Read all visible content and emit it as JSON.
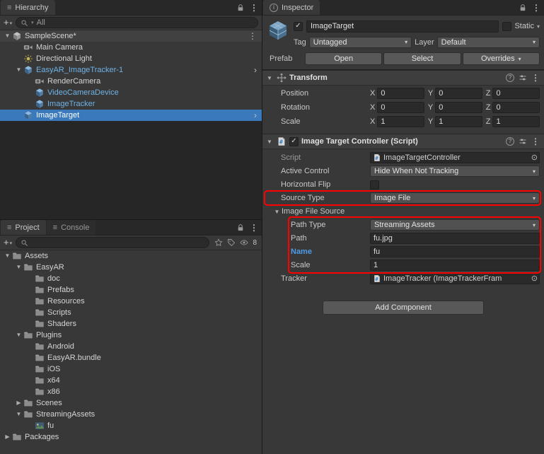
{
  "glyphs": {
    "hamburger": "≡",
    "kebab": "⋮",
    "caret": "▾",
    "plus": "+",
    "chevron": "›",
    "picker": "⊙",
    "check": "✓",
    "help": "?",
    "info": "i",
    "arrow_open": "▼",
    "arrow_closed": "▶"
  },
  "colors": {
    "selection": "#3a79bb",
    "prefab_text": "#6fb3e6",
    "highlight": "#ff0000"
  },
  "hierarchy": {
    "tab_label": "Hierarchy",
    "search_value": "All",
    "rows": [
      {
        "label": "SampleScene*",
        "icon": "unity-scene",
        "arrow": "▼",
        "indent": 0,
        "cls": "scene-row",
        "right": "⋮"
      },
      {
        "label": "Main Camera",
        "icon": "camera",
        "arrow": "",
        "indent": 1,
        "right": ""
      },
      {
        "label": "Directional Light",
        "icon": "light",
        "arrow": "",
        "indent": 1,
        "right": ""
      },
      {
        "label": "EasyAR_ImageTracker-1",
        "icon": "prefab-cube",
        "arrow": "▼",
        "indent": 1,
        "cls": "prefab",
        "right": "›"
      },
      {
        "label": "RenderCamera",
        "icon": "camera",
        "arrow": "",
        "indent": 2,
        "right": ""
      },
      {
        "label": "VideoCameraDevice",
        "icon": "prefab-cube",
        "arrow": "",
        "indent": 2,
        "cls": "prefab",
        "right": ""
      },
      {
        "label": "ImageTracker",
        "icon": "prefab-cube",
        "arrow": "",
        "indent": 2,
        "cls": "prefab",
        "right": ""
      },
      {
        "label": "ImageTarget",
        "icon": "prefab-cube",
        "arrow": "",
        "indent": 1,
        "cls": "selected",
        "right": "›"
      }
    ]
  },
  "project": {
    "tab_label": "Project",
    "console_tab_label": "Console",
    "search_value": "",
    "hidden_count": "8",
    "rows": [
      {
        "label": "Assets",
        "icon": "folder",
        "arrow": "▼",
        "indent": 0
      },
      {
        "label": "EasyAR",
        "icon": "folder",
        "arrow": "▼",
        "indent": 1
      },
      {
        "label": "doc",
        "icon": "folder",
        "arrow": "",
        "indent": 2
      },
      {
        "label": "Prefabs",
        "icon": "folder",
        "arrow": "",
        "indent": 2
      },
      {
        "label": "Resources",
        "icon": "folder",
        "arrow": "",
        "indent": 2
      },
      {
        "label": "Scripts",
        "icon": "folder",
        "arrow": "",
        "indent": 2
      },
      {
        "label": "Shaders",
        "icon": "folder",
        "arrow": "",
        "indent": 2
      },
      {
        "label": "Plugins",
        "icon": "folder",
        "arrow": "▼",
        "indent": 1
      },
      {
        "label": "Android",
        "icon": "folder",
        "arrow": "",
        "indent": 2
      },
      {
        "label": "EasyAR.bundle",
        "icon": "folder",
        "arrow": "",
        "indent": 2
      },
      {
        "label": "iOS",
        "icon": "folder",
        "arrow": "",
        "indent": 2
      },
      {
        "label": "x64",
        "icon": "folder",
        "arrow": "",
        "indent": 2
      },
      {
        "label": "x86",
        "icon": "folder",
        "arrow": "",
        "indent": 2
      },
      {
        "label": "Scenes",
        "icon": "folder",
        "arrow": "▶",
        "indent": 1
      },
      {
        "label": "StreamingAssets",
        "icon": "folder",
        "arrow": "▼",
        "indent": 1
      },
      {
        "label": "fu",
        "icon": "image",
        "arrow": "",
        "indent": 2
      },
      {
        "label": "Packages",
        "icon": "folder",
        "arrow": "▶",
        "indent": 0
      }
    ]
  },
  "inspector": {
    "tab_label": "Inspector",
    "header": {
      "name": "ImageTarget",
      "static_label": "Static",
      "tag_label": "Tag",
      "tag_value": "Untagged",
      "layer_label": "Layer",
      "layer_value": "Default",
      "prefab_label": "Prefab",
      "open_label": "Open",
      "select_label": "Select",
      "overrides_label": "Overrides"
    },
    "transform": {
      "title": "Transform",
      "axes": [
        "X",
        "Y",
        "Z"
      ],
      "rows": [
        {
          "label": "Position",
          "x": "0",
          "y": "0",
          "z": "0"
        },
        {
          "label": "Rotation",
          "x": "0",
          "y": "0",
          "z": "0"
        },
        {
          "label": "Scale",
          "x": "1",
          "y": "1",
          "z": "1"
        }
      ]
    },
    "controller": {
      "title": "Image Target Controller (Script)",
      "script_label": "Script",
      "script_value": "ImageTargetController",
      "active_control_label": "Active Control",
      "active_control_value": "Hide When Not Tracking",
      "horizontal_flip_label": "Horizontal Flip",
      "source_type_label": "Source Type",
      "source_type_value": "Image File",
      "image_file_source_label": "Image File Source",
      "path_type_label": "Path Type",
      "path_type_value": "Streaming Assets",
      "path_label": "Path",
      "path_value": "fu.jpg",
      "name_label": "Name",
      "name_value": "fu",
      "scale_label": "Scale",
      "scale_value": "1",
      "tracker_label": "Tracker",
      "tracker_value": "ImageTracker (ImageTrackerFram"
    },
    "add_component_label": "Add Component"
  }
}
